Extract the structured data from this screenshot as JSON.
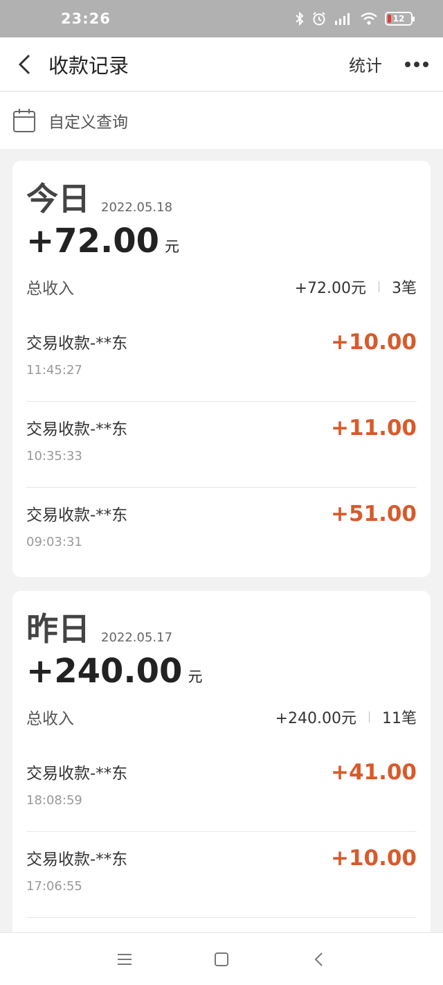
{
  "status_bar": {
    "time": "23:26",
    "battery": "12"
  },
  "header": {
    "title": "收款记录",
    "stat_label": "统计"
  },
  "filter": {
    "label": "自定义查询"
  },
  "days": [
    {
      "day": "今日",
      "date": "2022.05.18",
      "amount": "+72.00",
      "unit": "元",
      "summary_label": "总收入",
      "summary_amount": "+72.00元",
      "summary_count": "3笔",
      "transactions": [
        {
          "title": "交易收款-**东",
          "time": "11:45:27",
          "amount": "+10.00"
        },
        {
          "title": "交易收款-**东",
          "time": "10:35:33",
          "amount": "+11.00"
        },
        {
          "title": "交易收款-**东",
          "time": "09:03:31",
          "amount": "+51.00"
        }
      ]
    },
    {
      "day": "昨日",
      "date": "2022.05.17",
      "amount": "+240.00",
      "unit": "元",
      "summary_label": "总收入",
      "summary_amount": "+240.00元",
      "summary_count": "11笔",
      "transactions": [
        {
          "title": "交易收款-**东",
          "time": "18:08:59",
          "amount": "+41.00"
        },
        {
          "title": "交易收款-**东",
          "time": "17:06:55",
          "amount": "+10.00"
        }
      ]
    }
  ],
  "colors": {
    "accent": "#d85a2b",
    "status_bar": "#b1b1b1"
  }
}
